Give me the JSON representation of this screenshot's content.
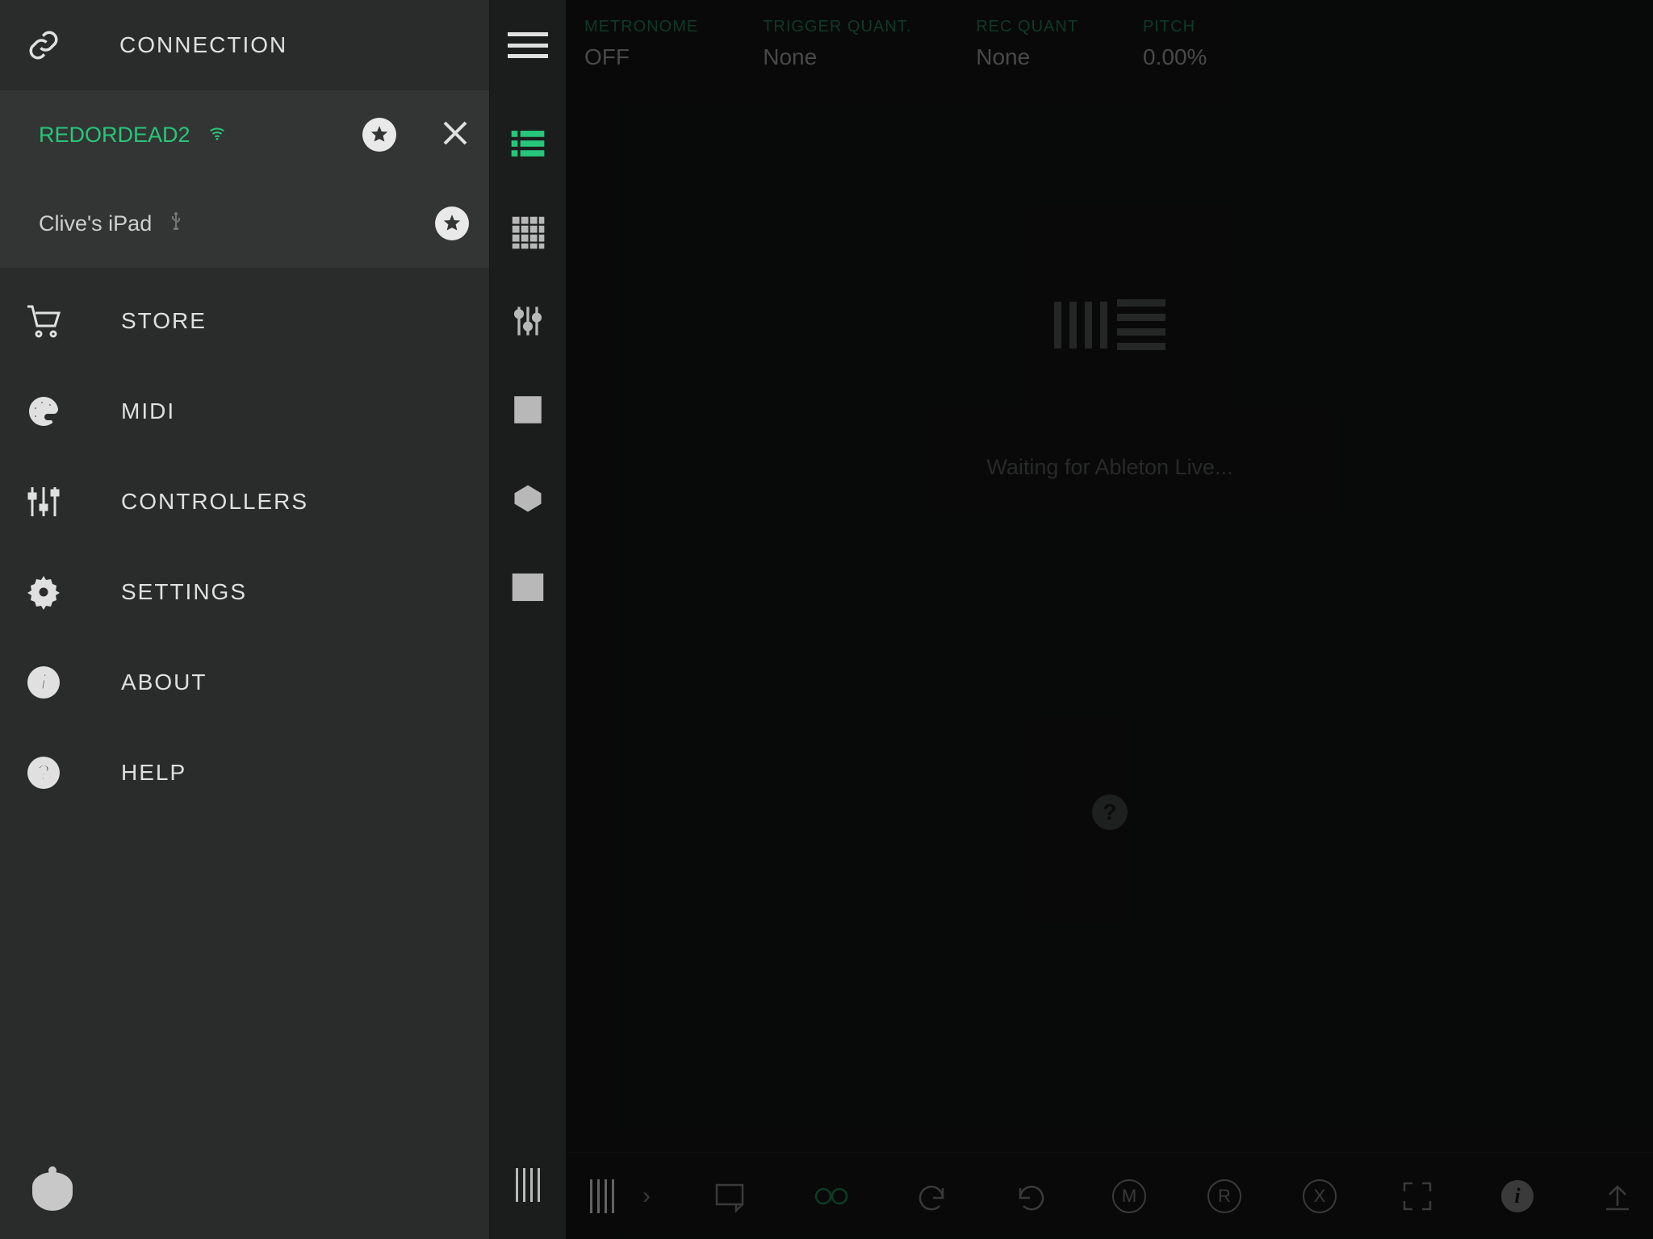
{
  "sidebar": {
    "title": "CONNECTION",
    "devices": [
      {
        "name": "REDORDEAD2",
        "active": true,
        "conn_type": "wifi",
        "starred": true,
        "closeable": true
      },
      {
        "name": "Clive's iPad",
        "active": false,
        "conn_type": "usb",
        "starred": true,
        "closeable": false
      }
    ],
    "menu": [
      {
        "label": "STORE",
        "icon": "cart-icon"
      },
      {
        "label": "MIDI",
        "icon": "palette-icon"
      },
      {
        "label": "CONTROLLERS",
        "icon": "sliders-icon"
      },
      {
        "label": "SETTINGS",
        "icon": "gear-icon"
      },
      {
        "label": "ABOUT",
        "icon": "info-icon"
      },
      {
        "label": "HELP",
        "icon": "help-icon"
      }
    ]
  },
  "toolstrip": {
    "views": [
      {
        "name": "list-view-icon",
        "active": true
      },
      {
        "name": "grid-view-icon",
        "active": false
      },
      {
        "name": "mixer-view-icon",
        "active": false
      },
      {
        "name": "device-view-icon",
        "active": false
      },
      {
        "name": "module-view-icon",
        "active": false
      },
      {
        "name": "keys-view-icon",
        "active": false
      }
    ]
  },
  "topbar": {
    "metrics": [
      {
        "label": "METRONOME",
        "value": "OFF"
      },
      {
        "label": "TRIGGER QUANT.",
        "value": "None"
      },
      {
        "label": "REC QUANT",
        "value": "None"
      },
      {
        "label": "PITCH",
        "value": "0.00%"
      }
    ]
  },
  "main": {
    "status_text": "Waiting for Ableton Live..."
  },
  "bottombar": {
    "items": [
      {
        "name": "tracks-icon"
      },
      {
        "name": "expand-right-icon"
      },
      {
        "name": "return-clip-icon"
      },
      {
        "name": "loop-icon",
        "accent": true
      },
      {
        "name": "undo-icon"
      },
      {
        "name": "redo-icon"
      },
      {
        "name": "mute-icon",
        "glyph": "M"
      },
      {
        "name": "record-icon",
        "glyph": "R"
      },
      {
        "name": "delete-icon",
        "glyph": "X"
      },
      {
        "name": "fullscreen-icon"
      },
      {
        "name": "info-icon"
      },
      {
        "name": "upload-icon"
      }
    ]
  }
}
